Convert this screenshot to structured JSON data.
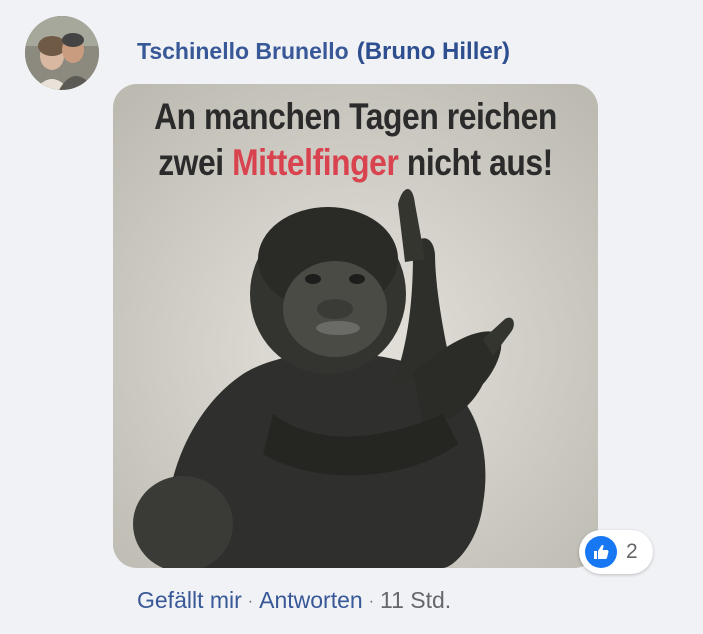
{
  "comment": {
    "author_name": "Tschinello Brunello",
    "author_alias": "(Bruno Hiller)",
    "image": {
      "line1": "An manchen Tagen reichen",
      "line2_before": "zwei",
      "line2_highlight": "Mittelfinger",
      "line2_after": "nicht aus!",
      "highlight_color": "#d8434f"
    },
    "reactions": {
      "icon": "thumbs-up-icon",
      "count": "2"
    },
    "actions": {
      "like_label": "Gefällt mir",
      "separator": "·",
      "reply_label": "Antworten",
      "timestamp": "11 Std."
    }
  },
  "colors": {
    "background": "#f0f2f5",
    "link": "#385898",
    "like_blue": "#1877f2",
    "meta_gray": "#65676b"
  }
}
